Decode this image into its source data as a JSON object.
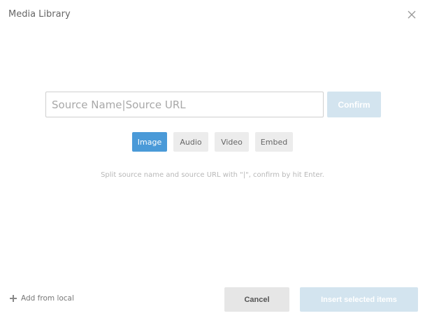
{
  "dialog": {
    "title": "Media Library"
  },
  "source": {
    "placeholder": "Source Name|Source URL",
    "value": "",
    "confirm_label": "Confirm"
  },
  "media_types": [
    {
      "label": "Image",
      "active": true
    },
    {
      "label": "Audio",
      "active": false
    },
    {
      "label": "Video",
      "active": false
    },
    {
      "label": "Embed",
      "active": false
    }
  ],
  "hint": "Split source name and source URL with \"|\", confirm by hit Enter.",
  "footer": {
    "add_local_label": "Add from local",
    "cancel_label": "Cancel",
    "insert_label": "Insert selected items"
  },
  "colors": {
    "accent": "#4a9ad8",
    "disabled_button": "#d3e4ef",
    "neutral_button": "#e6e6e6"
  },
  "icons": {
    "close": "close-icon",
    "add": "plus-icon"
  }
}
